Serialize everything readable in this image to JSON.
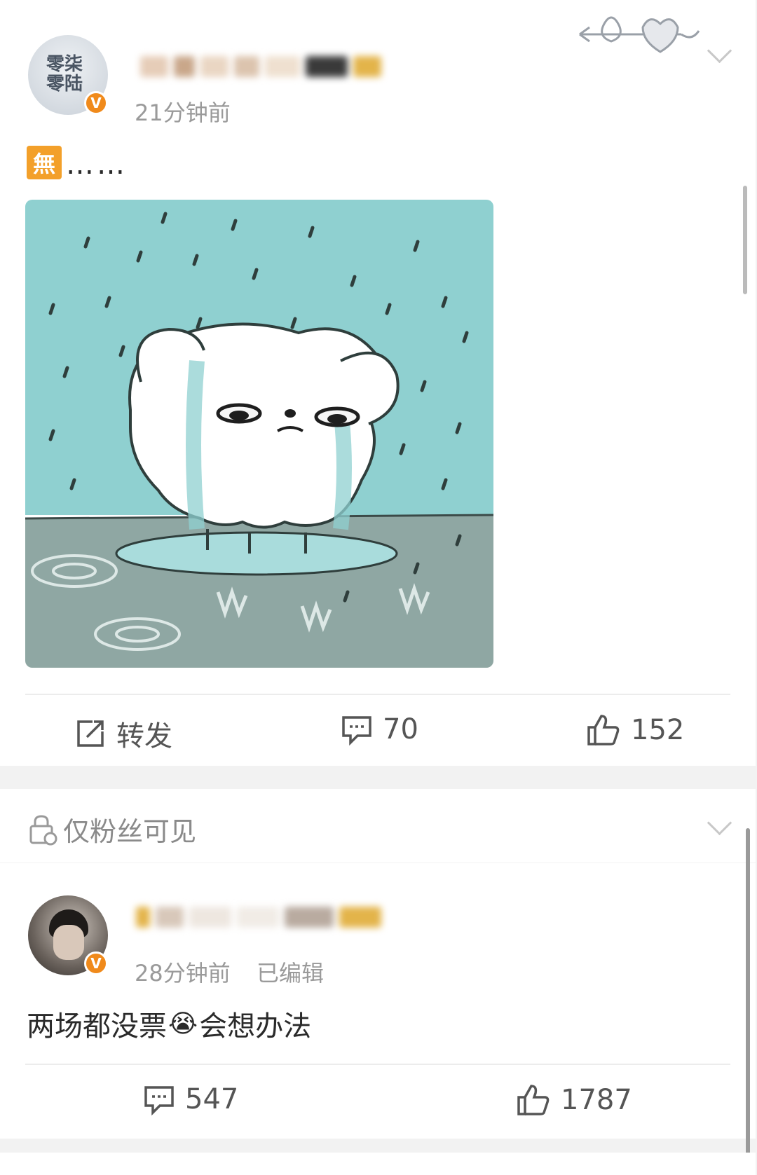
{
  "post1": {
    "avatar_text_line1": "零柒",
    "avatar_text_line2": "零陆",
    "verified_mark": "V",
    "time": "21分钟前",
    "emoji_badge": "無",
    "content": "……",
    "image_icon": "crying-dog-in-rain",
    "actions": {
      "repost_label": "转发",
      "comment_count": "70",
      "like_count": "152"
    }
  },
  "post2_header": {
    "visibility_label": "仅粉丝可见"
  },
  "post2": {
    "verified_mark": "V",
    "time": "28分钟前",
    "edited_label": "已编辑",
    "content_part1": "两场都没票",
    "content_part2": "会想办法",
    "emoji": "😭",
    "actions": {
      "comment_count": "547",
      "like_count": "1787"
    }
  },
  "colors": {
    "verified": "#f08a1b",
    "sky": "#8fd0d0",
    "ground": "#8fa7a3",
    "emoji_badge_bg": "#f3a02a"
  }
}
